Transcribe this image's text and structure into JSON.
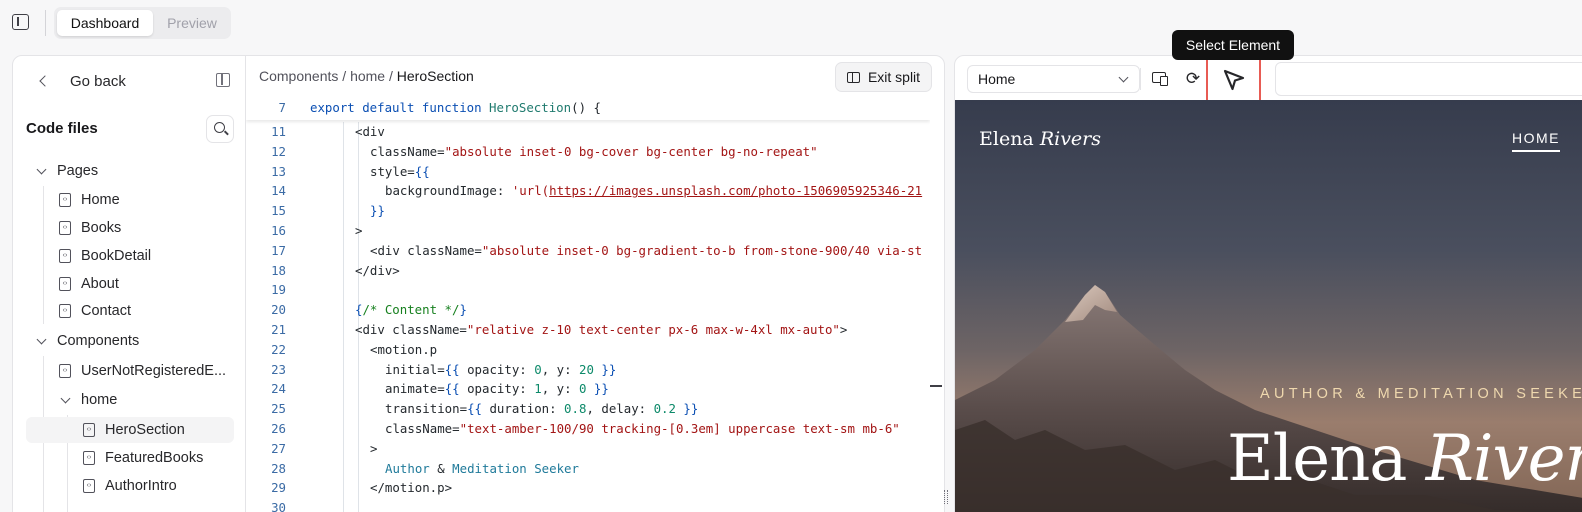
{
  "topbar": {
    "tabs": [
      {
        "label": "Dashboard",
        "active": true
      },
      {
        "label": "Preview",
        "active": false
      }
    ]
  },
  "sidebar": {
    "back_label": "Go back",
    "code_files_title": "Code files",
    "tree": {
      "pages_label": "Pages",
      "pages": [
        "Home",
        "Books",
        "BookDetail",
        "About",
        "Contact"
      ],
      "components_label": "Components",
      "components": [
        "UserNotRegisteredE..."
      ],
      "home_folder_label": "home",
      "home_files": [
        "HeroSection",
        "FeaturedBooks",
        "AuthorIntro"
      ],
      "active_file": "HeroSection"
    }
  },
  "editor": {
    "breadcrumb": {
      "part1": "Components",
      "sep": "/",
      "part2": "home",
      "part3": "HeroSection"
    },
    "exit_split_label": "Exit split",
    "sticky_line": {
      "num": "7",
      "parts": [
        [
          "export default function ",
          "#0b4fb3"
        ],
        [
          "HeroSection",
          "#1f7a6e"
        ],
        [
          "() {",
          "#24292e"
        ]
      ]
    },
    "lines": [
      {
        "num": "11",
        "indent": 3,
        "parts": [
          [
            "<div",
            "#24292e"
          ]
        ]
      },
      {
        "num": "12",
        "indent": 4,
        "parts": [
          [
            "className=",
            "#24292e"
          ],
          [
            "\"absolute inset-0 bg-cover bg-center bg-no-repeat\"",
            "#a31515"
          ]
        ]
      },
      {
        "num": "13",
        "indent": 4,
        "parts": [
          [
            "style=",
            "#24292e"
          ],
          [
            "{{",
            "#0b4fb3"
          ]
        ]
      },
      {
        "num": "14",
        "indent": 5,
        "parts": [
          [
            "backgroundImage: ",
            "#24292e"
          ],
          [
            "'url(",
            "#a31515"
          ],
          [
            "https://images.unsplash.com/photo-1506905925346-21",
            "#a31515",
            true
          ]
        ]
      },
      {
        "num": "15",
        "indent": 4,
        "parts": [
          [
            "}}",
            "#0b4fb3"
          ]
        ]
      },
      {
        "num": "16",
        "indent": 3,
        "parts": [
          [
            ">",
            "#24292e"
          ]
        ]
      },
      {
        "num": "17",
        "indent": 4,
        "parts": [
          [
            "<div className=",
            "#24292e"
          ],
          [
            "\"absolute inset-0 bg-gradient-to-b from-stone-900/40 via-st",
            "#a31515"
          ]
        ]
      },
      {
        "num": "18",
        "indent": 3,
        "parts": [
          [
            "</div>",
            "#24292e"
          ]
        ]
      },
      {
        "num": "19",
        "indent": 0,
        "parts": []
      },
      {
        "num": "20",
        "indent": 3,
        "parts": [
          [
            "{",
            "#0b4fb3"
          ],
          [
            "/* Content */",
            "#17801f"
          ],
          [
            "}",
            "#0b4fb3"
          ]
        ]
      },
      {
        "num": "21",
        "indent": 3,
        "parts": [
          [
            "<div className=",
            "#24292e"
          ],
          [
            "\"relative z-10 text-center px-6 max-w-4xl mx-auto\"",
            "#a31515"
          ],
          [
            ">",
            "#24292e"
          ]
        ]
      },
      {
        "num": "22",
        "indent": 4,
        "parts": [
          [
            "<motion.p",
            "#24292e"
          ]
        ]
      },
      {
        "num": "23",
        "indent": 5,
        "parts": [
          [
            "initial=",
            "#24292e"
          ],
          [
            "{{",
            "#0b4fb3"
          ],
          [
            " opacity: ",
            "#24292e"
          ],
          [
            "0",
            "#0d8a6a"
          ],
          [
            ", y: ",
            "#24292e"
          ],
          [
            "20",
            "#0d8a6a"
          ],
          [
            " }}",
            "#0b4fb3"
          ]
        ]
      },
      {
        "num": "24",
        "indent": 5,
        "parts": [
          [
            "animate=",
            "#24292e"
          ],
          [
            "{{",
            "#0b4fb3"
          ],
          [
            " opacity: ",
            "#24292e"
          ],
          [
            "1",
            "#0d8a6a"
          ],
          [
            ", y: ",
            "#24292e"
          ],
          [
            "0",
            "#0d8a6a"
          ],
          [
            " }}",
            "#0b4fb3"
          ]
        ]
      },
      {
        "num": "25",
        "indent": 5,
        "parts": [
          [
            "transition=",
            "#24292e"
          ],
          [
            "{{",
            "#0b4fb3"
          ],
          [
            " duration: ",
            "#24292e"
          ],
          [
            "0.8",
            "#0d8a6a"
          ],
          [
            ", delay: ",
            "#24292e"
          ],
          [
            "0.2",
            "#0d8a6a"
          ],
          [
            " }}",
            "#0b4fb3"
          ]
        ]
      },
      {
        "num": "26",
        "indent": 5,
        "parts": [
          [
            "className=",
            "#24292e"
          ],
          [
            "\"text-amber-100/90 tracking-[0.3em] uppercase text-sm mb-6\"",
            "#a31515"
          ]
        ]
      },
      {
        "num": "27",
        "indent": 4,
        "parts": [
          [
            ">",
            "#24292e"
          ]
        ]
      },
      {
        "num": "28",
        "indent": 5,
        "parts": [
          [
            "Author",
            "#1f7a9a"
          ],
          [
            " & ",
            "#24292e"
          ],
          [
            "Meditation Seeker",
            "#1f7a9a"
          ]
        ]
      },
      {
        "num": "29",
        "indent": 4,
        "parts": [
          [
            "</motion.p>",
            "#24292e"
          ]
        ]
      },
      {
        "num": "30",
        "indent": 0,
        "parts": []
      }
    ]
  },
  "preview": {
    "page_select": "Home",
    "tooltip": "Select Element",
    "site": {
      "brand_first": "Elena",
      "brand_last": "Rivers",
      "nav_home": "HOME",
      "eyebrow": "AUTHOR & MEDITATION SEEKER",
      "hero_first": "Elena",
      "hero_last": "Rivers"
    }
  },
  "colors": {
    "highlight": "#e85b53",
    "tooltip_bg": "#111111"
  }
}
